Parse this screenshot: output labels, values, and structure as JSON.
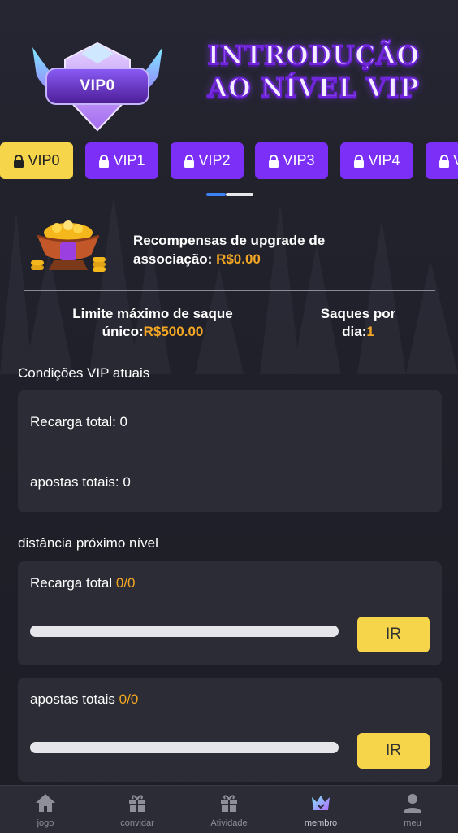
{
  "header": {
    "badge_label": "VIP0",
    "title_line1": "INTRODUÇÃO",
    "title_line2": "AO NÍVEL VIP"
  },
  "tabs": [
    {
      "label": "VIP0",
      "active": true
    },
    {
      "label": "VIP1",
      "active": false
    },
    {
      "label": "VIP2",
      "active": false
    },
    {
      "label": "VIP3",
      "active": false
    },
    {
      "label": "VIP4",
      "active": false
    },
    {
      "label": "V",
      "active": false
    }
  ],
  "rewards": {
    "label": "Recompensas de upgrade de associação: ",
    "value": "R$0.00"
  },
  "limits": {
    "withdraw_label": "Limite máximo de saque único:",
    "withdraw_value": "R$500.00",
    "per_day_label": "Saques por dia:",
    "per_day_value": "1"
  },
  "current_conditions": {
    "title": "Condições VIP atuais",
    "recharge": "Recarga total: 0",
    "bets": "apostas totais: 0"
  },
  "next_level": {
    "title": "distância próximo nível",
    "items": [
      {
        "label": "Recarga total",
        "value": "0/0",
        "progress": 0,
        "button": "IR"
      },
      {
        "label": "apostas totais",
        "value": "0/0",
        "progress": 0,
        "button": "IR"
      }
    ]
  },
  "nav": [
    {
      "label": "jogo",
      "icon": "home-icon"
    },
    {
      "label": "convidar",
      "icon": "gift-icon"
    },
    {
      "label": "Atividade",
      "icon": "gift-icon"
    },
    {
      "label": "membro",
      "icon": "crown-icon",
      "active": true
    },
    {
      "label": "meu",
      "icon": "user-icon"
    }
  ],
  "colors": {
    "accent": "#7b2ff7",
    "active_tab": "#f7d54a",
    "value_orange": "#f3a623"
  }
}
